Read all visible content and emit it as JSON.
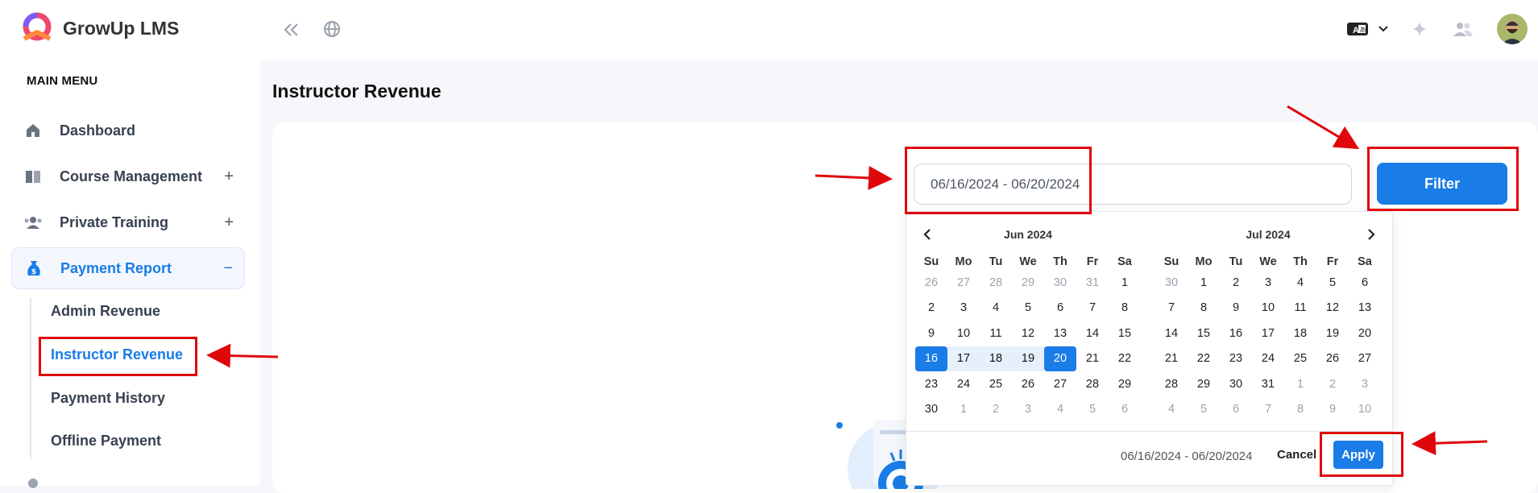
{
  "app": {
    "name": "GrowUp LMS"
  },
  "sidebar": {
    "menu_title": "MAIN MENU",
    "items": [
      {
        "label": "Dashboard",
        "icon": "home-icon",
        "expander": ""
      },
      {
        "label": "Course Management",
        "icon": "book-icon",
        "expander": "+"
      },
      {
        "label": "Private Training",
        "icon": "users-icon",
        "expander": "+"
      },
      {
        "label": "Payment Report",
        "icon": "money-bag-icon",
        "expander": "−"
      }
    ],
    "sub_items": [
      "Admin Revenue",
      "Instructor Revenue",
      "Payment History",
      "Offline Payment"
    ],
    "active_sub": "Instructor Revenue"
  },
  "topbar": {
    "icons": [
      "collapse-icon",
      "globe-icon",
      "language-icon",
      "chevron-down-icon",
      "sparkle-icon",
      "users-icon",
      "avatar"
    ]
  },
  "page": {
    "title": "Instructor Revenue"
  },
  "filter": {
    "date_range_value": "06/16/2024 - 06/20/2024",
    "filter_label": "Filter"
  },
  "datepicker": {
    "weekdays": [
      "Su",
      "Mo",
      "Tu",
      "We",
      "Th",
      "Fr",
      "Sa"
    ],
    "left": {
      "title": "Jun 2024",
      "weeks": [
        [
          "26",
          "27",
          "28",
          "29",
          "30",
          "31",
          "1"
        ],
        [
          "2",
          "3",
          "4",
          "5",
          "6",
          "7",
          "8"
        ],
        [
          "9",
          "10",
          "11",
          "12",
          "13",
          "14",
          "15"
        ],
        [
          "16",
          "17",
          "18",
          "19",
          "20",
          "21",
          "22"
        ],
        [
          "23",
          "24",
          "25",
          "26",
          "27",
          "28",
          "29"
        ],
        [
          "30",
          "1",
          "2",
          "3",
          "4",
          "5",
          "6"
        ]
      ]
    },
    "right": {
      "title": "Jul 2024",
      "weeks": [
        [
          "30",
          "1",
          "2",
          "3",
          "4",
          "5",
          "6"
        ],
        [
          "7",
          "8",
          "9",
          "10",
          "11",
          "12",
          "13"
        ],
        [
          "14",
          "15",
          "16",
          "17",
          "18",
          "19",
          "20"
        ],
        [
          "21",
          "22",
          "23",
          "24",
          "25",
          "26",
          "27"
        ],
        [
          "28",
          "29",
          "30",
          "31",
          "1",
          "2",
          "3"
        ],
        [
          "4",
          "5",
          "6",
          "7",
          "8",
          "9",
          "10"
        ]
      ]
    },
    "selected_start": "16",
    "selected_end": "20",
    "footer_range": "06/16/2024 - 06/20/2024",
    "cancel_label": "Cancel",
    "apply_label": "Apply"
  },
  "colors": {
    "accent": "#1a7ce6",
    "annotation": "#e0070b"
  }
}
